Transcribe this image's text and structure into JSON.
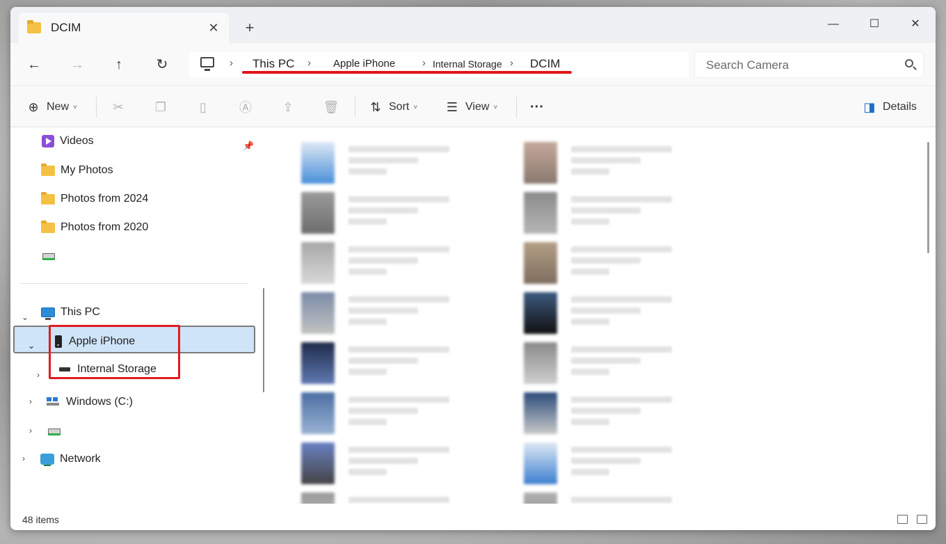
{
  "window": {
    "tab_title": "DCIM",
    "tab_close": "✕",
    "new_tab": "+",
    "minimize": "—",
    "maximize": "☐",
    "close": "✕"
  },
  "nav": {
    "back": "←",
    "forward": "→",
    "up": "↑",
    "refresh": "↻"
  },
  "breadcrumb": {
    "items": [
      "This PC",
      "Apple iPhone",
      "Internal Storage",
      "DCIM"
    ],
    "separator": "›"
  },
  "search": {
    "placeholder": "Search Camera"
  },
  "toolbar": {
    "new_label": "New",
    "sort_label": "Sort",
    "view_label": "View",
    "more_label": "···",
    "details_label": "Details",
    "caret": "˅"
  },
  "sidebar": {
    "quick_access": [
      {
        "label": "Videos",
        "icon": "video-icon"
      },
      {
        "label": "My Photos",
        "icon": "folder-icon"
      },
      {
        "label": "Photos from 2024",
        "icon": "folder-icon"
      },
      {
        "label": "Photos from 2020",
        "icon": "folder-icon"
      },
      {
        "label": "",
        "icon": "drive-icon"
      }
    ],
    "tree": [
      {
        "label": "This PC",
        "icon": "monitor-icon",
        "state": "expanded"
      },
      {
        "label": "Apple iPhone",
        "icon": "phone-icon",
        "state": "expanded",
        "selected": true
      },
      {
        "label": "Internal Storage",
        "icon": "storage-icon",
        "state": "collapsed"
      },
      {
        "label": "Windows (C:)",
        "icon": "windows-drive-icon",
        "state": "collapsed"
      },
      {
        "label": "",
        "icon": "drive-icon",
        "state": "collapsed"
      },
      {
        "label": "Network",
        "icon": "network-icon",
        "state": "collapsed"
      }
    ]
  },
  "status": {
    "item_count": "48 items"
  },
  "colors": {
    "accent_red": "#e01b1f",
    "selection": "#cfe4f7"
  }
}
